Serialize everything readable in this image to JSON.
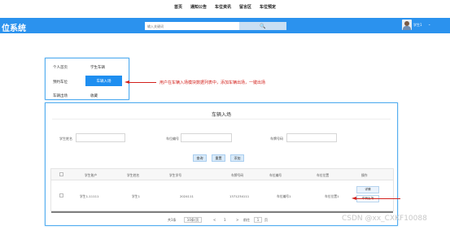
{
  "topnav": {
    "items": [
      "首页",
      "通知公告",
      "车位资讯",
      "留言区",
      "车位预定"
    ]
  },
  "header": {
    "brand": "位系统",
    "search_placeholder": "输入关键词",
    "search_button": "🔍",
    "username": "学生1",
    "user_dropdown": "⌄"
  },
  "side_menu": {
    "items": [
      {
        "label": "个人首页"
      },
      {
        "label": "学生车辆"
      },
      {
        "label": "预约车位"
      },
      {
        "label": "车辆入场"
      },
      {
        "label": "车辆出场"
      },
      {
        "label": "收藏"
      }
    ]
  },
  "annotation": {
    "text": "用户在车辆入场模块数据列表中，添加车辆出场，一键出场"
  },
  "main": {
    "title": "车辆入场",
    "filters": [
      {
        "label": "学生姓名",
        "value": ""
      },
      {
        "label": "车位编号",
        "value": ""
      },
      {
        "label": "车牌号码",
        "value": ""
      }
    ],
    "buttons": [
      "查询",
      "重置",
      "添加"
    ],
    "table": {
      "headers": [
        "",
        "学生账户",
        "学生姓名",
        "学生学号",
        "车牌号码",
        "车位编号",
        "车位位置",
        "操作"
      ],
      "row": {
        "cells": [
          "学生1-11111",
          "学生1",
          "2024111",
          "1371234111",
          "车位编号1",
          "车位位置1"
        ],
        "actions": [
          "详情",
          "车辆出场"
        ]
      }
    },
    "pager": {
      "total": "共1条",
      "page_size": "10条/页",
      "prev": "<",
      "page": "1",
      "next": ">",
      "goto_label": "前往",
      "goto_value": "1",
      "goto_unit": "页"
    }
  },
  "watermark": "CSDN @xx_CXKF10088",
  "colors": {
    "brand_blue": "#2b92ee",
    "annotation_red": "#d3211c"
  }
}
